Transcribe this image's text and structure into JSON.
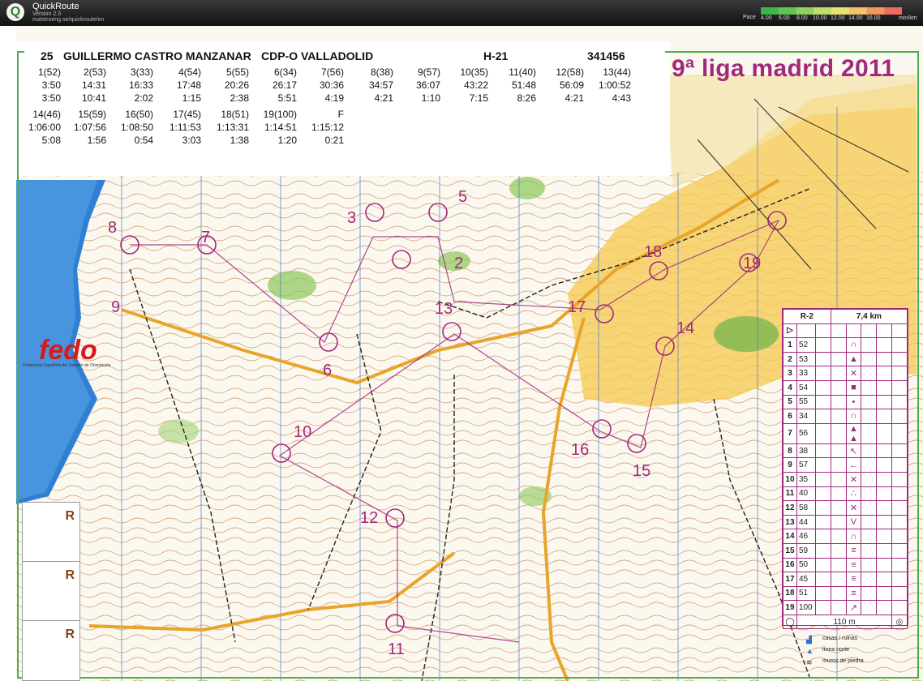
{
  "app": {
    "logo": "Q",
    "name": "QuickRoute",
    "version": "Version 2.3",
    "url": "matstroeng.se/quickroute/en"
  },
  "pace": {
    "label": "Pace",
    "ticks": [
      "4.00",
      "6.00",
      "8.00",
      "10.00",
      "12.00",
      "14.00",
      "16.00"
    ],
    "unit": "min/km",
    "colors": [
      "#3fb44a",
      "#62c253",
      "#8fd160",
      "#c1dd6a",
      "#e8e36f",
      "#f2c36a",
      "#f0965f",
      "#ec6d5b"
    ]
  },
  "runner": {
    "number": "25",
    "name": "GUILLERMO CASTRO MANZANAR",
    "club": "CDP-O VALLADOLID",
    "category": "H-21",
    "id": "341456"
  },
  "splits": [
    {
      "label": "1(52)",
      "total": "3:50",
      "split": "3:50"
    },
    {
      "label": "2(53)",
      "total": "14:31",
      "split": "10:41"
    },
    {
      "label": "3(33)",
      "total": "16:33",
      "split": "2:02"
    },
    {
      "label": "4(54)",
      "total": "17:48",
      "split": "1:15"
    },
    {
      "label": "5(55)",
      "total": "20:26",
      "split": "2:38"
    },
    {
      "label": "6(34)",
      "total": "26:17",
      "split": "5:51"
    },
    {
      "label": "7(56)",
      "total": "30:36",
      "split": "4:19"
    },
    {
      "label": "8(38)",
      "total": "34:57",
      "split": "4:21"
    },
    {
      "label": "9(57)",
      "total": "36:07",
      "split": "1:10"
    },
    {
      "label": "10(35)",
      "total": "43:22",
      "split": "7:15"
    },
    {
      "label": "11(40)",
      "total": "51:48",
      "split": "8:26"
    },
    {
      "label": "12(58)",
      "total": "56:09",
      "split": "4:21"
    },
    {
      "label": "13(44)",
      "total": "1:00:52",
      "split": "4:43"
    },
    {
      "label": "14(46)",
      "total": "1:06:00",
      "split": "5:08"
    },
    {
      "label": "15(59)",
      "total": "1:07:56",
      "split": "1:56"
    },
    {
      "label": "16(50)",
      "total": "1:08:50",
      "split": "0:54"
    },
    {
      "label": "17(45)",
      "total": "1:11:53",
      "split": "3:03"
    },
    {
      "label": "18(51)",
      "total": "1:13:31",
      "split": "1:38"
    },
    {
      "label": "19(100)",
      "total": "1:14:51",
      "split": "1:20"
    },
    {
      "label": "F",
      "total": "1:15:12",
      "split": "0:21"
    }
  ],
  "event_title": "9ª liga madrid 2011",
  "fedo": {
    "logo": "fedo",
    "subtitle": "Federación Española del Deporte de Orientación"
  },
  "r_box": [
    "R",
    "R",
    "R"
  ],
  "description_sheet": {
    "course": "R-2",
    "length": "7,4 km",
    "rows": [
      {
        "n": "1",
        "code": "52",
        "sym": "∩"
      },
      {
        "n": "2",
        "code": "53",
        "sym": "▲"
      },
      {
        "n": "3",
        "code": "33",
        "sym": "✕"
      },
      {
        "n": "4",
        "code": "54",
        "sym": "■"
      },
      {
        "n": "5",
        "code": "55",
        "sym": "•"
      },
      {
        "n": "6",
        "code": "34",
        "sym": "∩"
      },
      {
        "n": "7",
        "code": "56",
        "sym": "▲ ▲"
      },
      {
        "n": "8",
        "code": "38",
        "sym": "↖"
      },
      {
        "n": "9",
        "code": "57",
        "sym": "←"
      },
      {
        "n": "10",
        "code": "35",
        "sym": "✕"
      },
      {
        "n": "11",
        "code": "40",
        "sym": "∴"
      },
      {
        "n": "12",
        "code": "58",
        "sym": "✕"
      },
      {
        "n": "13",
        "code": "44",
        "sym": "V"
      },
      {
        "n": "14",
        "code": "46",
        "sym": "∩"
      },
      {
        "n": "15",
        "code": "59",
        "sym": "≡"
      },
      {
        "n": "16",
        "code": "50",
        "sym": "≡"
      },
      {
        "n": "17",
        "code": "45",
        "sym": "≡"
      },
      {
        "n": "18",
        "code": "51",
        "sym": "≡"
      },
      {
        "n": "19",
        "code": "100",
        "sym": "↗"
      }
    ],
    "footer": "110 m"
  },
  "legend": [
    "casas / ruinas",
    "línea norte",
    "muros de piedra"
  ],
  "control_numbers": [
    "2",
    "3",
    "5",
    "6",
    "7",
    "8",
    "9",
    "10",
    "11",
    "12",
    "13",
    "14",
    "15",
    "16",
    "17",
    "18",
    "19"
  ]
}
